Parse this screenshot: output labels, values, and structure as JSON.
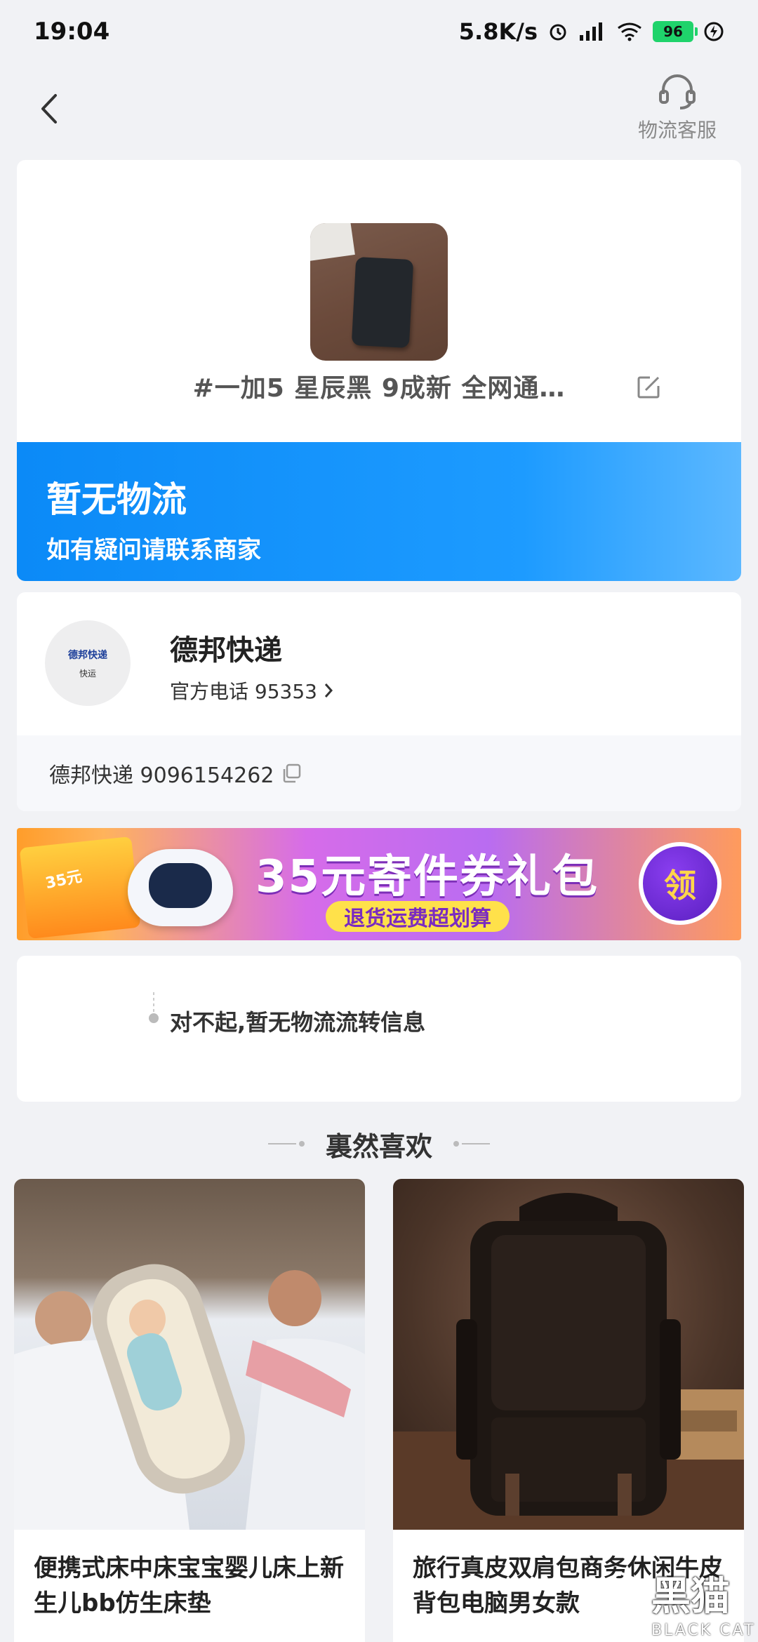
{
  "status_bar": {
    "time": "19:04",
    "net_speed": "5.8K/s",
    "battery": "96"
  },
  "header": {
    "service_label": "物流客服"
  },
  "product": {
    "name": "#一加5  星辰黑  9成新   全网通…"
  },
  "logistics_status": {
    "title": "暂无物流",
    "subtitle": "如有疑问请联系商家"
  },
  "courier": {
    "logo_brand": "德邦快递",
    "logo_sub": "快运",
    "name": "德邦快递",
    "phone_label": "官方电话 95353",
    "tracking": "德邦快递 9096154262"
  },
  "promo": {
    "coupon_tag": "35元",
    "title": "35元寄件券礼包",
    "subtitle": "退货运费超划算",
    "claim_label": "领"
  },
  "tracking_info": {
    "empty_message": "对不起,暂无物流流转信息"
  },
  "recommend": {
    "heading": "裏然喜欢",
    "items": [
      {
        "title": "便携式床中床宝宝婴儿床上新生儿bb仿生床垫"
      },
      {
        "title": "旅行真皮双肩包商务休闲牛皮背包电脑男女款"
      }
    ]
  },
  "watermark": {
    "text": "黑猫",
    "sub": "BLACK CAT"
  },
  "colors": {
    "accent_blue": "#0b8af7",
    "battery_green": "#1fd36b",
    "promo_purple": "#b96cf1"
  }
}
